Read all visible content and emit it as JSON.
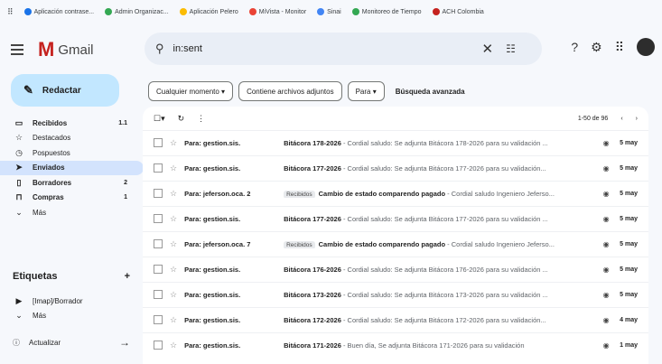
{
  "bookmarks": [
    {
      "label": "Aplicación contrase...",
      "color": "#1a73e8"
    },
    {
      "label": "Admin Organizac...",
      "color": "#34a853"
    },
    {
      "label": "Aplicación Pelero",
      "color": "#fbbc04"
    },
    {
      "label": "MiVista - Monitor",
      "color": "#ea4335"
    },
    {
      "label": "Sinai",
      "color": "#4285f4"
    },
    {
      "label": "Monitoreo de Tiempo",
      "color": "#34a853"
    },
    {
      "label": "ACH Colombia",
      "color": "#c5221f"
    }
  ],
  "header": {
    "app_name": "Gmail",
    "search_value": "in:sent",
    "search_icon": "search-icon",
    "clear_icon": "close-icon",
    "tune_icon": "tune-icon"
  },
  "compose_label": "Redactar",
  "nav": [
    {
      "label": "Recibidos",
      "count": "1.1",
      "icon": "inbox-icon"
    },
    {
      "label": "Destacados",
      "count": "",
      "icon": "star-icon"
    },
    {
      "label": "Pospuestos",
      "count": "",
      "icon": "clock-icon"
    },
    {
      "label": "Enviados",
      "count": "",
      "icon": "send-icon",
      "active": true
    },
    {
      "label": "Borradores",
      "count": "2",
      "icon": "draft-icon"
    },
    {
      "label": "Compras",
      "count": "1",
      "icon": "shopping-icon"
    },
    {
      "label": "Más",
      "count": "",
      "icon": "chevron-down-icon"
    }
  ],
  "labels_title": "Etiquetas",
  "labels_add": "+",
  "label_items": [
    {
      "label": "[Imap]/Borrador",
      "icon": "label-icon"
    },
    {
      "label": "Más",
      "icon": "chevron-down-icon"
    }
  ],
  "update_label": "Actualizar",
  "chips": [
    "Cualquier momento ▾",
    "Contiene archivos adjuntos",
    "Para ▾"
  ],
  "advanced_search": "Búsqueda avanzada",
  "pagination": "1-50 de 96",
  "emails": [
    {
      "from": "Para: gestion.sis.",
      "badge": "",
      "subject": "Bitácora 178-2026",
      "snippet": " - Cordial saludo: Se adjunta Bitácora 178-2026 para su validación ...",
      "date": "5 may"
    },
    {
      "from": "Para: gestion.sis.",
      "badge": "",
      "subject": "Bitácora 177-2026",
      "snippet": " - Cordial saludo: Se adjunta Bitácora 177-2026 para su validación...",
      "date": "5 may"
    },
    {
      "from": "Para: jeferson.oca. 2",
      "badge": "Recibidos",
      "subject": "Cambio de estado comparendo pagado",
      "snippet": " - Cordial saludo Ingeniero Jeferso...",
      "date": "5 may"
    },
    {
      "from": "Para: gestion.sis.",
      "badge": "",
      "subject": "Bitácora 177-2026",
      "snippet": " - Cordial saludo: Se adjunta Bitácora 177-2026 para su validación ...",
      "date": "5 may"
    },
    {
      "from": "Para: jeferson.oca. 7",
      "badge": "Recibidos",
      "subject": "Cambio de estado comparendo pagado",
      "snippet": " - Cordial saludo Ingeniero Jeferso...",
      "date": "5 may"
    },
    {
      "from": "Para: gestion.sis.",
      "badge": "",
      "subject": "Bitácora 176-2026",
      "snippet": " - Cordial saludo: Se adjunta Bitácora 176-2026 para su validación ...",
      "date": "5 may"
    },
    {
      "from": "Para: gestion.sis.",
      "badge": "",
      "subject": "Bitácora 173-2026",
      "snippet": " - Cordial saludo: Se adjunta Bitácora 173-2026 para su validación ...",
      "date": "5 may"
    },
    {
      "from": "Para: gestion.sis.",
      "badge": "",
      "subject": "Bitácora 172-2026",
      "snippet": " - Cordial saludo: Se adjunta Bitácora 172-2026 para su validación...",
      "date": "4 may"
    },
    {
      "from": "Para: gestion.sis.",
      "badge": "",
      "subject": "Bitácora 171-2026",
      "snippet": " - Buen día, Se adjunta Bitácora 171-2026 para su validación",
      "date": "1 may"
    }
  ]
}
